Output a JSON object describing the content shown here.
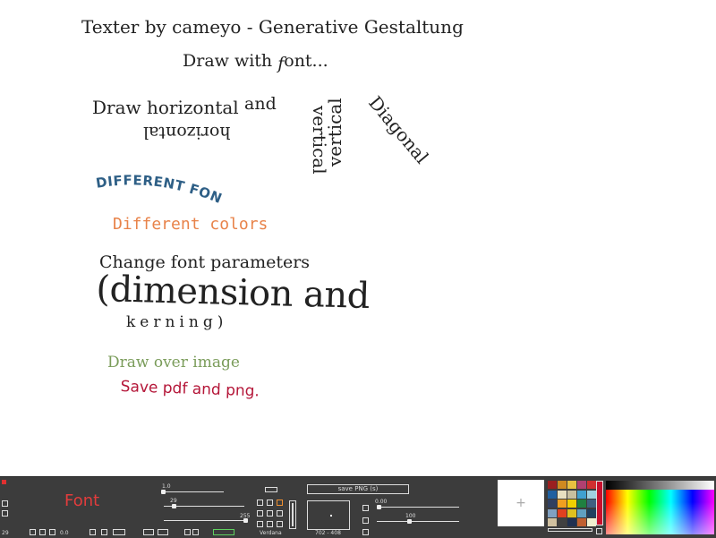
{
  "canvas": {
    "title": "Texter by cameyo - Generative Gestaltung",
    "draw_with": "Draw with ",
    "font_f": "f",
    "ont": "ont...",
    "draw_horizontal": "Draw horizontal",
    "horizontal_flipped": "horizontal",
    "and": "and",
    "vertical_1": "vertical",
    "vertical_2": "vertical",
    "diagonal": "Diagonal",
    "different_fonts": "DIFFERENT FONTS",
    "different_colors": "Different colors",
    "change_font": "Change font parameters",
    "dimension": "(dimension and",
    "kerning": "kerning)",
    "draw_over_image": "Draw over image",
    "save_pdf_png": "Save pdf and png.",
    "colors": {
      "different_fonts": "#2e5f86",
      "different_colors": "#e8834a",
      "draw_over_image": "#7a9c5a",
      "save": "#b5183a",
      "text": "#222222"
    }
  },
  "toolbar": {
    "frame_count": "29",
    "font_label": "Font",
    "font_label_color": "#e23c3c",
    "size_value": "1.0",
    "kerning_value": "29",
    "alpha_value": "255",
    "offset_value": "0.0",
    "font_name": "Verdana",
    "save_button": "save PNG (s)",
    "coordinates": "702 - 408",
    "angle_value": "0.00",
    "zoom_value": "100",
    "add_symbol": "+",
    "palette": [
      "#9b2020",
      "#d08a20",
      "#e8c040",
      "#b04070",
      "#d03030",
      "#2060a0",
      "#e8e0c0",
      "#c8c0a0",
      "#40a0d0",
      "#a0d0e0",
      "#304060",
      "#f0a020",
      "#f0d000",
      "#208040",
      "#406080",
      "#80a0c0",
      "#e04020",
      "#e0c020",
      "#60a0c0",
      "#204060",
      "#d0c0a0",
      "#404040",
      "#203050",
      "#c06030",
      "#f0f0d0"
    ]
  }
}
